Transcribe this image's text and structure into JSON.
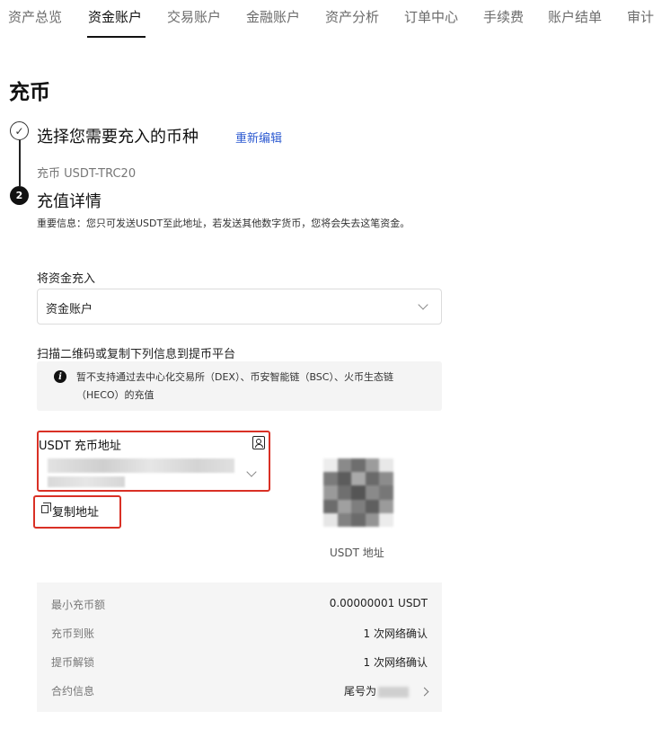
{
  "nav": {
    "tabs": [
      {
        "label": "资产总览",
        "active": false
      },
      {
        "label": "资金账户",
        "active": true
      },
      {
        "label": "交易账户",
        "active": false
      },
      {
        "label": "金融账户",
        "active": false
      },
      {
        "label": "资产分析",
        "active": false
      },
      {
        "label": "订单中心",
        "active": false
      },
      {
        "label": "手续费",
        "active": false
      },
      {
        "label": "账户结单",
        "active": false
      },
      {
        "label": "审计",
        "active": false
      }
    ]
  },
  "page": {
    "title": "充币"
  },
  "step1": {
    "number": "✓",
    "title": "选择您需要充入的币种",
    "reedit_label": "重新编辑",
    "selected_coin": "充币 USDT-TRC20"
  },
  "step2": {
    "number": "2",
    "title": "充值详情",
    "notice": "重要信息：您只可发送USDT至此地址，若发送其他数字货币，您将会失去这笔资金。"
  },
  "deposit_to": {
    "label": "将资金充入",
    "selected": "资金账户"
  },
  "scan": {
    "label": "扫描二维码或复制下列信息到提币平台",
    "info_icon": "i",
    "info_text": "暂不支持通过去中心化交易所（DEX）、币安智能链（BSC）、火币生态链（HECO）的充值"
  },
  "address": {
    "label": "USDT 充币地址",
    "copy_label": "复制地址",
    "qr_label": "USDT 地址"
  },
  "details": [
    {
      "key": "最小充币额",
      "value": "0.00000001 USDT"
    },
    {
      "key": "充币到账",
      "value": "1 次网络确认"
    },
    {
      "key": "提币解锁",
      "value": "1 次网络确认"
    },
    {
      "key": "合约信息",
      "value": "尾号为"
    }
  ],
  "colors": {
    "highlight_border": "#d93025",
    "link": "#2e5bd1",
    "panel_bg": "#f5f5f5"
  }
}
